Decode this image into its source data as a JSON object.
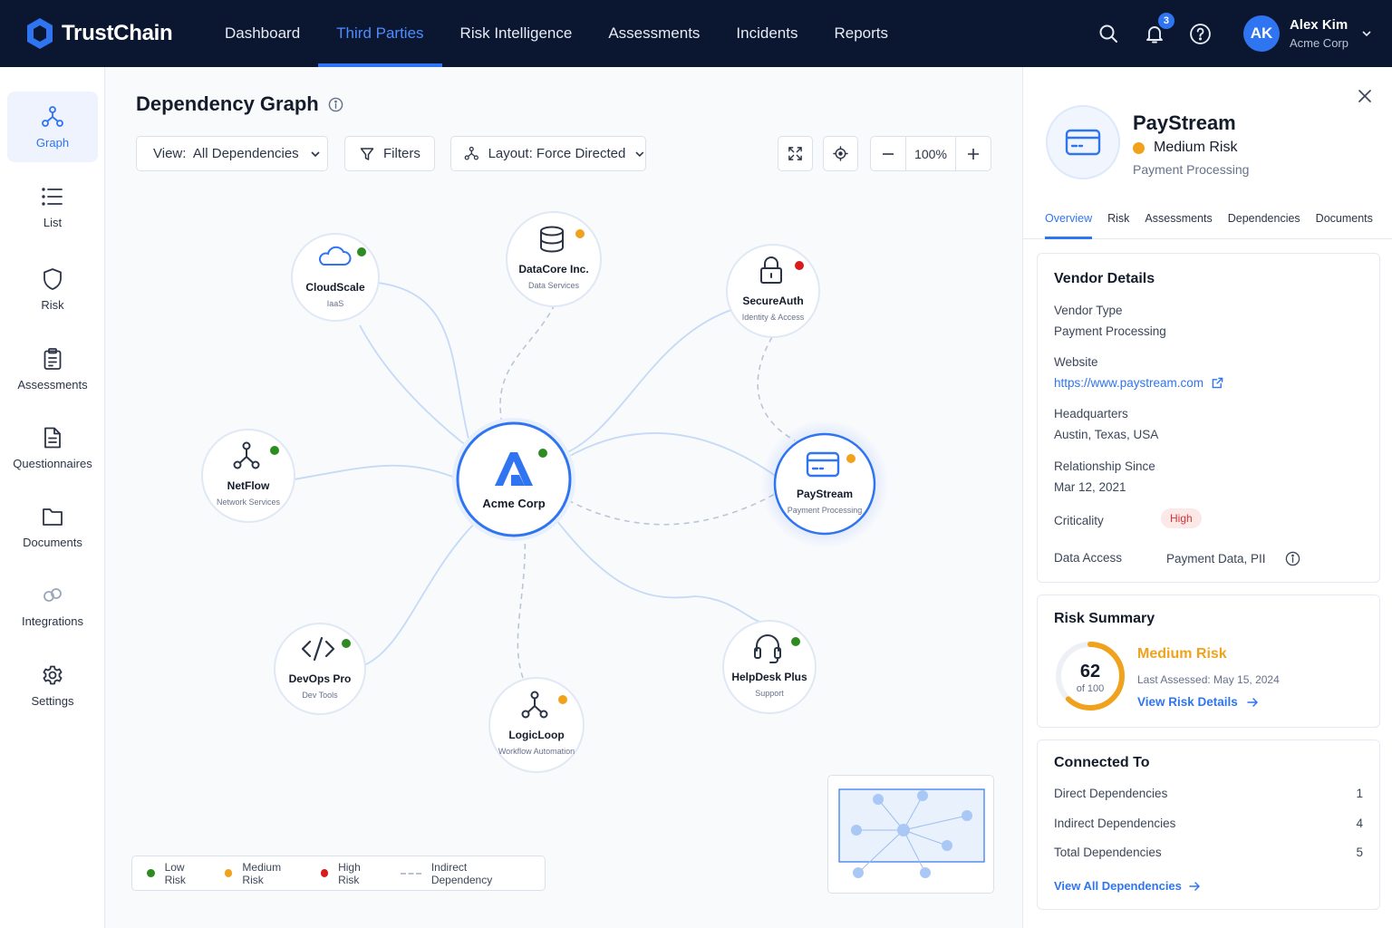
{
  "brand": {
    "name": "TrustChain"
  },
  "nav": [
    {
      "label": "Dashboard",
      "active": false
    },
    {
      "label": "Third Parties",
      "active": true
    },
    {
      "label": "Risk Intelligence",
      "active": false
    },
    {
      "label": "Assessments",
      "active": false
    },
    {
      "label": "Incidents",
      "active": false
    },
    {
      "label": "Reports",
      "active": false
    }
  ],
  "header": {
    "notification_count": "3"
  },
  "user": {
    "initials": "AK",
    "name": "Alex Kim",
    "org": "Acme Corp"
  },
  "sidebar": [
    {
      "label": "Graph",
      "icon": "graph-icon",
      "active": true
    },
    {
      "label": "List",
      "icon": "list-icon",
      "active": false
    },
    {
      "label": "Risk",
      "icon": "shield-icon",
      "active": false
    },
    {
      "label": "Assessments",
      "icon": "clipboard-icon",
      "active": false
    },
    {
      "label": "Questionnaires",
      "icon": "document-icon",
      "active": false
    },
    {
      "label": "Documents",
      "icon": "folder-icon",
      "active": false
    },
    {
      "label": "Integrations",
      "icon": "integrations-icon",
      "active": false
    },
    {
      "label": "Settings",
      "icon": "gear-icon",
      "active": false
    }
  ],
  "main": {
    "title": "Dependency Graph",
    "toolbar": {
      "view_label": "View:  All Dependencies",
      "filters_label": "Filters",
      "layout_label": "Layout: Force Directed",
      "zoom": "100%"
    },
    "legend": {
      "low": "Low Risk",
      "medium": "Medium Risk",
      "high": "High Risk",
      "indirect": "Indirect Dependency"
    }
  },
  "colors": {
    "accent": "#2f74f0",
    "navy": "#0b1630",
    "low_risk": "#2e8b1f",
    "medium_risk": "#f0a21c",
    "high_risk": "#d81b1b",
    "edge": "#c4daf6"
  },
  "graph": {
    "center": {
      "name": "Acme Corp",
      "icon": "acme-logo-icon",
      "risk": "low"
    },
    "nodes": [
      {
        "id": "cloudscale",
        "name": "CloudScale",
        "sub": "IaaS",
        "icon": "cloud-icon",
        "risk": "low"
      },
      {
        "id": "datacore",
        "name": "DataCore Inc.",
        "sub": "Data Services",
        "icon": "database-icon",
        "risk": "medium"
      },
      {
        "id": "secureauth",
        "name": "SecureAuth",
        "sub": "Identity & Access",
        "icon": "lock-icon",
        "risk": "high"
      },
      {
        "id": "netflow",
        "name": "NetFlow",
        "sub": "Network Services",
        "icon": "network-icon",
        "risk": "low"
      },
      {
        "id": "paystream",
        "name": "PayStream",
        "sub": "Payment Processing",
        "icon": "credit-card-icon",
        "risk": "medium",
        "selected": true
      },
      {
        "id": "devops",
        "name": "DevOps Pro",
        "sub": "Dev Tools",
        "icon": "code-icon",
        "risk": "low"
      },
      {
        "id": "logicloop",
        "name": "LogicLoop",
        "sub": "Workflow Automation",
        "icon": "workflow-icon",
        "risk": "medium"
      },
      {
        "id": "helpdesk",
        "name": "HelpDesk Plus",
        "sub": "Support",
        "icon": "headset-icon",
        "risk": "low"
      }
    ],
    "edges": [
      {
        "from": "acme",
        "to": "cloudscale",
        "type": "direct"
      },
      {
        "from": "acme",
        "to": "datacore",
        "type": "indirect"
      },
      {
        "from": "acme",
        "to": "secureauth",
        "type": "direct"
      },
      {
        "from": "acme",
        "to": "netflow",
        "type": "direct"
      },
      {
        "from": "acme",
        "to": "paystream",
        "type": "direct"
      },
      {
        "from": "acme",
        "to": "paystream",
        "type": "indirect"
      },
      {
        "from": "acme",
        "to": "devops",
        "type": "direct"
      },
      {
        "from": "acme",
        "to": "logicloop",
        "type": "indirect"
      },
      {
        "from": "acme",
        "to": "helpdesk",
        "type": "direct"
      },
      {
        "from": "secureauth",
        "to": "paystream",
        "type": "indirect"
      }
    ]
  },
  "panel": {
    "vendor": {
      "name": "PayStream",
      "risk_label": "Medium Risk",
      "category": "Payment Processing"
    },
    "tabs": [
      {
        "label": "Overview",
        "active": true
      },
      {
        "label": "Risk",
        "active": false
      },
      {
        "label": "Assessments",
        "active": false
      },
      {
        "label": "Dependencies",
        "active": false
      },
      {
        "label": "Documents",
        "active": false
      }
    ],
    "details": {
      "title": "Vendor Details",
      "vendor_type_label": "Vendor Type",
      "vendor_type": "Payment Processing",
      "website_label": "Website",
      "website": "https://www.paystream.com",
      "hq_label": "Headquarters",
      "hq": "Austin, Texas, USA",
      "since_label": "Relationship Since",
      "since": "Mar 12, 2021",
      "criticality_label": "Criticality",
      "criticality": "High",
      "data_access_label": "Data Access",
      "data_access": "Payment Data, PII"
    },
    "risk_summary": {
      "title": "Risk Summary",
      "score": "62",
      "score_max": "of 100",
      "score_fraction": 0.62,
      "level": "Medium Risk",
      "last_assessed": "Last Assessed: May 15, 2024",
      "link": "View Risk Details"
    },
    "connected": {
      "title": "Connected To",
      "rows": [
        {
          "label": "Direct Dependencies",
          "value": "1"
        },
        {
          "label": "Indirect Dependencies",
          "value": "4"
        },
        {
          "label": "Total Dependencies",
          "value": "5"
        }
      ],
      "link": "View All Dependencies"
    }
  }
}
